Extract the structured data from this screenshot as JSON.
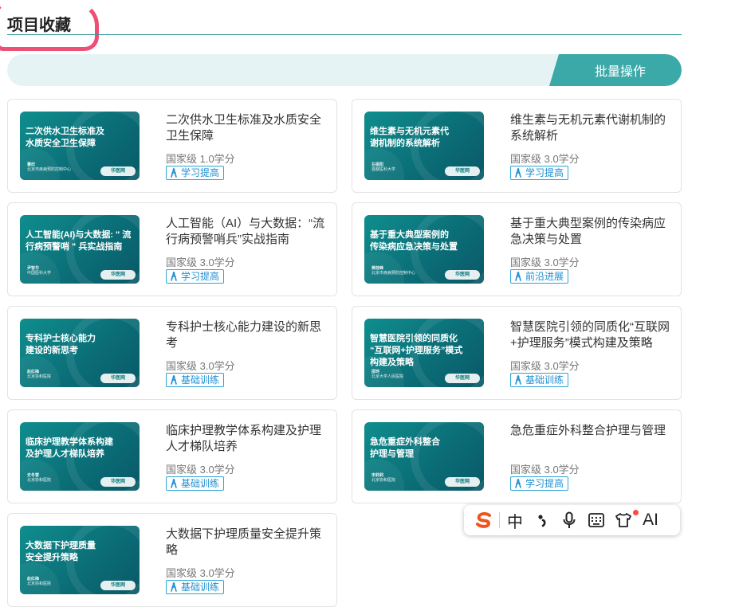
{
  "header": {
    "title": "项目收藏"
  },
  "toolbar": {
    "batch_label": "批量操作"
  },
  "courses": [
    {
      "thumb_title": "二次供水卫生标准及\n水质安全卫生保障",
      "thumb_author": "董欣",
      "thumb_org": "北京市疾病预防控制中心",
      "title": "二次供水卫生标准及水质安全卫生保障",
      "meta": "国家级 1.0学分",
      "tag": "学习提高"
    },
    {
      "thumb_title": "维生素与无机元素代\n谢机制的系统解析",
      "thumb_author": "左振阳",
      "thumb_org": "首都医科大学",
      "title": "维生素与无机元素代谢机制的系统解析",
      "meta": "国家级 3.0学分",
      "tag": "学习提高"
    },
    {
      "thumb_title": "人工智能(AI)与大数据: \" 流\n行病预警哨 \" 兵实战指南",
      "thumb_author": "尹智华",
      "thumb_org": "中国医科大学",
      "title": "人工智能（AI）与大数据：“流行病预警哨兵”实战指南",
      "meta": "国家级 3.0学分",
      "tag": "学习提高"
    },
    {
      "thumb_title": "基于重大典型案例的\n传染病应急决策与处置",
      "thumb_author": "黄桂峰",
      "thumb_org": "北京市疾病预防控制中心",
      "title": "基于重大典型案例的传染病应急决策与处置",
      "meta": "国家级 3.0学分",
      "tag": "前沿进展"
    },
    {
      "thumb_title": "专科护士核心能力\n建设的新思考",
      "thumb_author": "赵红梅",
      "thumb_org": "北京协和医院",
      "title": "专科护士核心能力建设的新思考",
      "meta": "国家级 3.0学分",
      "tag": "基础训练"
    },
    {
      "thumb_title": "智慧医院引领的同质化\n“互联网+护理服务”模式\n构建及策略",
      "thumb_author": "邵珂",
      "thumb_org": "北京大学人民医院",
      "title": "智慧医院引领的同质化“互联网+护理服务”模式构建及策略",
      "meta": "国家级 3.0学分",
      "tag": "基础训练"
    },
    {
      "thumb_title": "临床护理教学体系构建\n及护理人才梯队培养",
      "thumb_author": "史冬雷",
      "thumb_org": "北京协和医院",
      "title": "临床护理教学体系构建及护理人才梯队培养",
      "meta": "国家级 3.0学分",
      "tag": "基础训练"
    },
    {
      "thumb_title": "急危重症外科整合\n护理与管理",
      "thumb_author": "宋莉莉",
      "thumb_org": "北京协和医院",
      "title": "急危重症外科整合护理与管理",
      "meta": "国家级 3.0学分",
      "tag": "学习提高"
    },
    {
      "thumb_title": "大数据下护理质量\n安全提升策略",
      "thumb_author": "赵红梅",
      "thumb_org": "北京协和医院",
      "title": "大数据下护理质量安全提升策略",
      "meta": "国家级 3.0学分",
      "tag": "基础训练"
    }
  ],
  "brand": {
    "logo_text": "华医网",
    "accent": "#3aa9a8",
    "tag_color": "#1e8fd0",
    "highlight": "#ee4f74"
  },
  "ime_toolbar": {
    "items": [
      "sogou-logo",
      "中",
      "punctuation",
      "microphone",
      "keyboard",
      "skin",
      "AI"
    ]
  }
}
